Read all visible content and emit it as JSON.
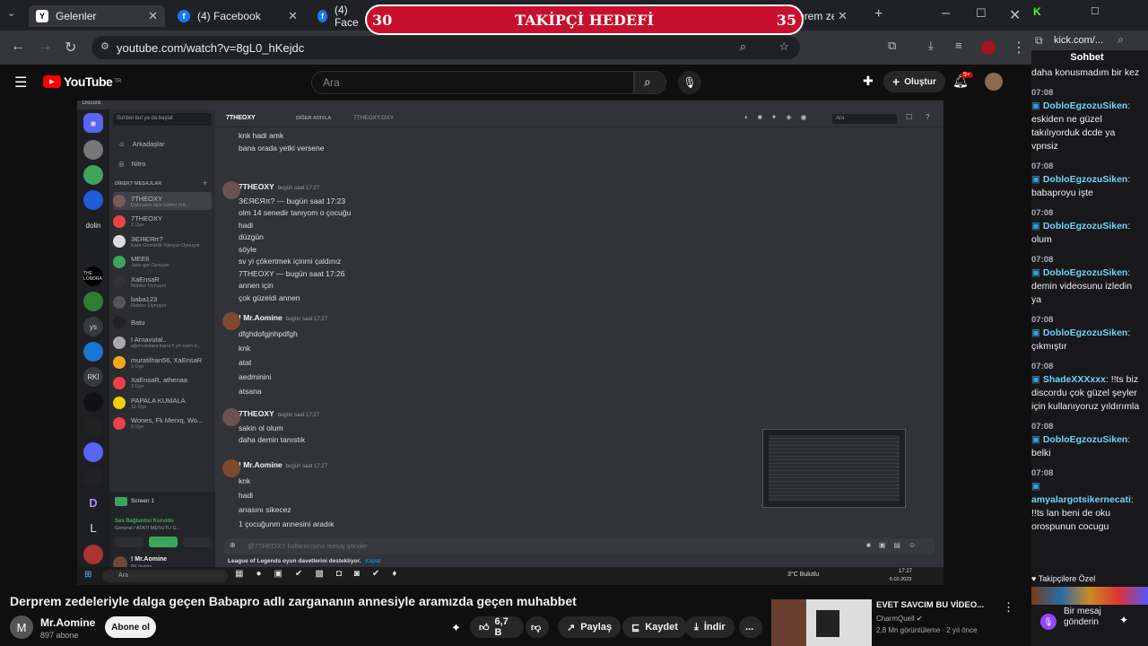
{
  "tabs": [
    {
      "label": "Gelenler",
      "icon": "Y"
    },
    {
      "label": "(4) Facebook",
      "icon": "f"
    },
    {
      "label": "(4) Face",
      "icon": "f"
    },
    {
      "label": "(18) Deprem zede",
      "icon": "▶"
    }
  ],
  "url": "youtube.com/watch?v=8gL0_hKejdc",
  "banner": {
    "left": "30",
    "title": "TAKİPÇİ HEDEFİ",
    "right": "35"
  },
  "youtube": {
    "logo": "YouTube",
    "logo_sup": "TR",
    "search_placeholder": "Ara",
    "create": "Oluştur",
    "notif": "9+"
  },
  "discord": {
    "app": "Discord",
    "search_placeholder": "Sohbet bul ya da başlat",
    "friends": "Arkadaşlar",
    "nitro": "Nitro",
    "dm_header": "DİREKT MESAJLAR",
    "channel": "7THEOXY",
    "other_name_label": "DİĞER ADIYLA",
    "other_name": "7THEOXY.OXY",
    "top_search": "Ara",
    "server_labels": [
      "dolin",
      "THE LONDRA",
      "ys",
      "RKİ",
      "D",
      "L"
    ],
    "dms": [
      {
        "name": "7THEOXY",
        "sub": "Dalmasın diye (istim) örtt...",
        "color": "#7a5c5a"
      },
      {
        "name": "7THEOXY",
        "sub": "2 Üye",
        "color": "#ed4245"
      },
      {
        "name": "ЗЄЯЄЯπ?",
        "sub": "Kara Gözlerlik Yanıyor Oynuyor",
        "color": "#ddd"
      },
      {
        "name": "MEE6",
        "sub": "Jack-gpt Oynuyor",
        "color": "#3ba55c"
      },
      {
        "name": "XaEnsaR",
        "sub": "Roblox Oynuyor",
        "color": "#333"
      },
      {
        "name": "baba123",
        "sub": "Roblox Oynuyor",
        "color": "#555"
      },
      {
        "name": "Batu",
        "sub": "",
        "color": "#222"
      },
      {
        "name": "I Arnavutal..",
        "sub": "ağı/cvantara bana 5 yıl esim d...",
        "color": "#aaa"
      },
      {
        "name": "muratilhan56, XaEnsaR",
        "sub": "3 Üye",
        "color": "#faa61a"
      },
      {
        "name": "XaEnsaR, athenaa",
        "sub": "3 Üye",
        "color": "#ed4245"
      },
      {
        "name": "PAPALA KUMALA",
        "sub": "10 Üye",
        "color": "#f0d000"
      },
      {
        "name": "Wones, Fk Merxq, Wo...",
        "sub": "8 Üye",
        "color": "#ed4245"
      }
    ],
    "screen": "Screen 1",
    "voice_status": "Ses Bağlantısı Kuruldu",
    "voice_channel": "General / ATATI MESUTU G...",
    "user": "! Mr.Aomine",
    "user_sub": "BE /pvntra...",
    "messages": [
      {
        "lines": [
          "knk hadi amk",
          "bana orada yetki versene"
        ]
      },
      {
        "name": "7THEOXY",
        "ts": "bugün saat 17:27",
        "lines": [
          "ЗЄЯЄЯπ? — bugün saat 17:23",
          "olm 14 senedir tanıyom o çocuğu",
          "hadi",
          "düzgün",
          "söyle",
          "sv yi çökertmek içinmi  çaldınız",
          "7THEOXY — bugün saat 17:26",
          "annen için",
          "çok güzeldi annen"
        ]
      },
      {
        "name": "! Mr.Aomine",
        "ts": "bugün saat 17:27",
        "lines": [
          "dfghdofgjnhpdfgh",
          "knk",
          "atat",
          "aedminini",
          "atsana"
        ]
      },
      {
        "name": "7THEOXY",
        "ts": "bugün saat 17:27",
        "lines": [
          "sakin ol olum",
          "daha demin tanıstık"
        ]
      },
      {
        "name": "! Mr.Aomine",
        "ts": "bugün saat 17:27",
        "lines": [
          "knk",
          "hadi",
          "anasını sikecez",
          "1 çocuğunm annesini aradık"
        ]
      }
    ],
    "input_placeholder": "@7THEOXY kullanıcısına mesaj gönder",
    "lol_notice": "League of Legends oyun davetlerini destekliyor.",
    "lol_link": "Kapat",
    "taskbar_search": "Ara",
    "weather": "3°C  Bulutlu",
    "time": "17:27",
    "date": "6.02.2023"
  },
  "video_title": "Derprem zedeleriyle dalga geçen Babapro adlı zargananın annesiyle aramızda geçen muhabbet",
  "channel": {
    "name": "Mr.Aomine",
    "avatar": "M",
    "subs": "897 abone",
    "subscribe": "Abone ol"
  },
  "actions": {
    "likes": "6,7 B",
    "share": "Paylaş",
    "save": "Kaydet",
    "download": "İndir",
    "more": "..."
  },
  "related": {
    "title": "EVET SAVCIM BU VİDEO...",
    "channel": "CharmQuell",
    "meta": "2,8 Mn görüntüleme · 2 yıl önce"
  },
  "chat": {
    "url": "kick.com/...",
    "title": "Sohbet",
    "messages": [
      {
        "time": "",
        "user": "",
        "text": "daha konusmadım bir kez"
      },
      {
        "time": "07:08",
        "user": "DobloEgzozuSiken",
        "text": ": eskiden ne güzel takılıyorduk dcde ya vpnsiz"
      },
      {
        "time": "07:08",
        "user": "DobloEgzozuSiken",
        "text": ": babaproyu işte"
      },
      {
        "time": "07:08",
        "user": "DobloEgzozuSiken",
        "text": ": olum"
      },
      {
        "time": "07:08",
        "user": "DobloEgzozuSiken",
        "text": ": demin videosunu izledin ya"
      },
      {
        "time": "07:08",
        "user": "DobloEgzozuSiken",
        "text": ": çıkmıştır"
      },
      {
        "time": "07:08",
        "user": "ShadeXXXxxx",
        "text": ": !!ts biz discordu çok güzel şeyler için kullanıyoruz yıldırımla"
      },
      {
        "time": "07:08",
        "user": "DobloEgzozuSiken",
        "text": ": belki"
      },
      {
        "time": "07:08",
        "user": "amyalargotsikernecati",
        "text": ": !!ts lan beni de oku orospunun cocugu"
      }
    ],
    "followers_label": "Takipçilere Özel",
    "input_placeholder": "Bir mesaj gönderin"
  }
}
